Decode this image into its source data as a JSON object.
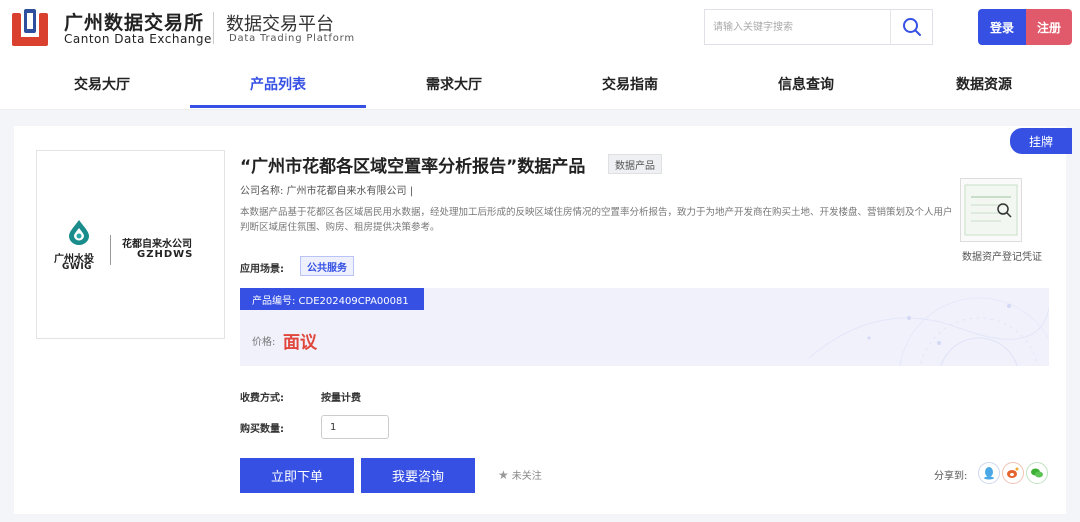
{
  "header": {
    "brand_cn": "广州数据交易所",
    "brand_en": "Canton Data Exchange",
    "platform_cn": "数据交易平台",
    "platform_en": "Data Trading Platform",
    "search_placeholder": "请输入关键字搜索",
    "login_label": "登录",
    "register_label": "注册"
  },
  "nav": {
    "items": [
      {
        "label": "交易大厅"
      },
      {
        "label": "产品列表"
      },
      {
        "label": "需求大厅"
      },
      {
        "label": "交易指南"
      },
      {
        "label": "信息查询"
      },
      {
        "label": "数据资源"
      }
    ],
    "active_index": 1
  },
  "product": {
    "listed_tag": "挂牌",
    "logo": {
      "brand_cn": "广州水投",
      "brand_en": "GWIG",
      "company_cn": "花都自来水公司",
      "company_en": "GZHDWS"
    },
    "title": "“广州市花都各区域空置率分析报告”数据产品",
    "type_badge": "数据产品",
    "company_line": "公司名称: 广州市花都自来水有限公司   |",
    "description": "本数据产品基于花都区各区域居民用水数据，经处理加工后形成的反映区域住房情况的空置率分析报告，致力于为地产开发商在购买土地、开发楼盘、营销策划及个人用户判断区域居住氛围、购房、租房提供决策参考。",
    "scene_label": "应用场景:",
    "scene_tag": "公共服务",
    "code": "产品编号: CDE202409CPA00081",
    "price_label": "价格:",
    "price_value": "面议",
    "cert_label": "数据资产登记凭证",
    "fee_label": "收费方式:",
    "fee_value": "按量计费",
    "qty_label": "购买数量:",
    "qty_value": "1",
    "order_label": "立即下单",
    "consult_label": "我要咨询",
    "follow_label": "未关注",
    "share_label": "分享到:"
  },
  "colors": {
    "primary": "#3650e4",
    "register": "#e15a6b",
    "price": "#e0463c",
    "logo_teal": "#1a8c8c"
  }
}
